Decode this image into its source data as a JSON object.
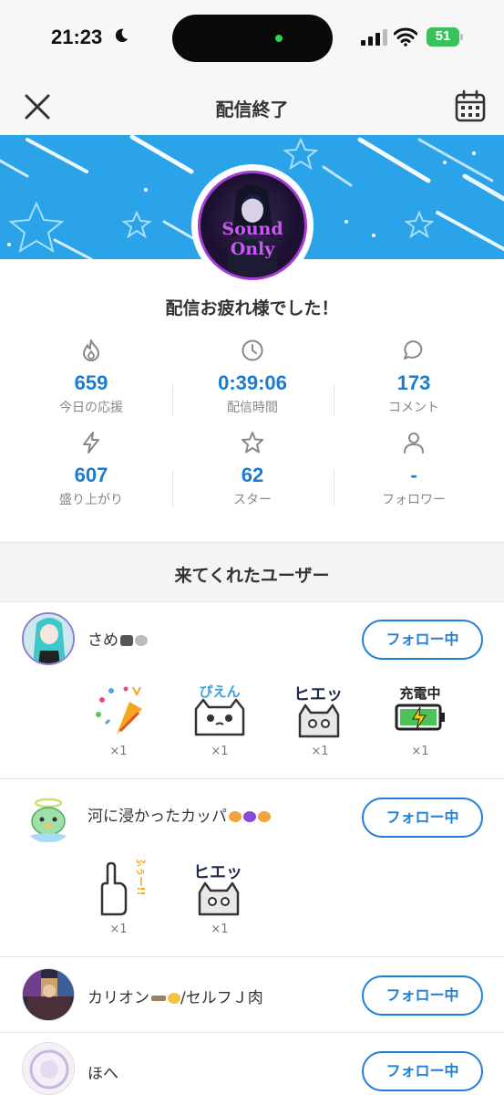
{
  "status_bar": {
    "time": "21:23",
    "battery": "51"
  },
  "header": {
    "title": "配信終了"
  },
  "profile": {
    "avatar_text_line1": "Sound",
    "avatar_text_line2": "Only"
  },
  "thanks_message": "配信お疲れ様でした！",
  "stats": [
    {
      "icon": "flame-icon",
      "value": "659",
      "label": "今日の応援"
    },
    {
      "icon": "clock-icon",
      "value": "0:39:06",
      "label": "配信時間"
    },
    {
      "icon": "comment-icon",
      "value": "173",
      "label": "コメント"
    },
    {
      "icon": "lightning-icon",
      "value": "607",
      "label": "盛り上がり"
    },
    {
      "icon": "star-icon",
      "value": "62",
      "label": "スター"
    },
    {
      "icon": "person-icon",
      "value": "-",
      "label": "フォロワー"
    }
  ],
  "visitors_title": "来てくれたユーザー",
  "users": [
    {
      "name": "さめ",
      "follow_label": "フォロー中",
      "stickers": [
        {
          "name": "party-popper-sticker",
          "count": "×1"
        },
        {
          "name": "pien-cat-sticker",
          "label": "ぴえん",
          "count": "×1"
        },
        {
          "name": "hie-cat-sticker",
          "label": "ヒエッ",
          "count": "×1"
        },
        {
          "name": "charging-sticker",
          "label": "充電中",
          "count": "×1"
        }
      ]
    },
    {
      "name": "河に浸かったカッパ",
      "follow_label": "フォロー中",
      "stickers": [
        {
          "name": "fuu-hand-sticker",
          "label": "ふぅー!!",
          "count": "×1"
        },
        {
          "name": "hie-cat-sticker",
          "label": "ヒエッ",
          "count": "×1"
        }
      ]
    },
    {
      "name": "カリオン",
      "name_suffix": "/セルフＪ肉",
      "follow_label": "フォロー中"
    },
    {
      "name": "ほへ",
      "follow_label": "フォロー中"
    }
  ],
  "colors": {
    "accent": "#1f7fd6",
    "banner": "#2aa3e8",
    "avatar_ring": "#a63cd6"
  }
}
